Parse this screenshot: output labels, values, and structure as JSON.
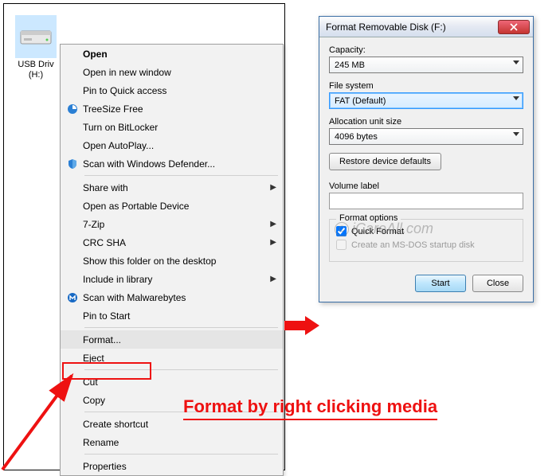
{
  "drive": {
    "label_line1": "USB Driv",
    "label_line2": "(H:)"
  },
  "context_menu": {
    "open": "Open",
    "open_new": "Open in new window",
    "pin_quick": "Pin to Quick access",
    "treesize": "TreeSize Free",
    "bitlocker": "Turn on BitLocker",
    "autoplay": "Open AutoPlay...",
    "defender": "Scan with Windows Defender...",
    "share_with": "Share with",
    "open_portable": "Open as Portable Device",
    "sevenzip": "7-Zip",
    "crcsha": "CRC SHA",
    "show_desktop": "Show this folder on the desktop",
    "include_lib": "Include in library",
    "scan_mwb": "Scan with Malwarebytes",
    "pin_start": "Pin to Start",
    "format": "Format...",
    "eject": "Eject",
    "cut": "Cut",
    "copy": "Copy",
    "shortcut": "Create shortcut",
    "rename": "Rename",
    "properties": "Properties"
  },
  "dialog": {
    "title": "Format Removable Disk (F:)",
    "capacity_label": "Capacity:",
    "capacity_value": "245 MB",
    "fs_label": "File system",
    "fs_value": "FAT (Default)",
    "aus_label": "Allocation unit size",
    "aus_value": "4096 bytes",
    "restore": "Restore device defaults",
    "vol_label": "Volume label",
    "group_label": "Format options",
    "quick_format": "Quick Format",
    "msdos": "Create an MS-DOS startup disk",
    "start": "Start",
    "close": "Close"
  },
  "annotation": {
    "text": "Format by right clicking media"
  },
  "watermark": {
    "text": "iCareAll.com",
    "c": "C"
  }
}
